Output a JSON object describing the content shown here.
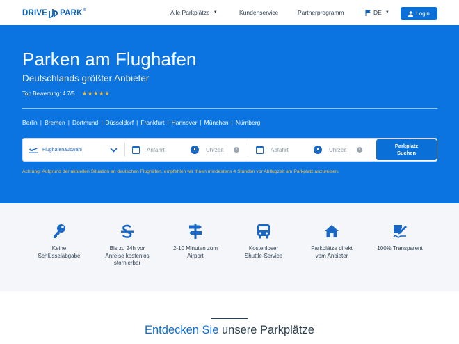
{
  "header": {
    "logo_left": "DRIVE",
    "logo_right": "PARK",
    "logo_reg": "®",
    "nav": {
      "parking": "Alle Parkplätze",
      "service": "Kundenservice",
      "partner": "Partnerprogramm",
      "language": "DE"
    },
    "login_label": "Login"
  },
  "hero": {
    "title": "Parken am Flughafen",
    "subtitle": "Deutschlands größter Anbieter",
    "rating_label": "Top Bewertung: 4.7/5",
    "stars": "★★★★★",
    "cities": [
      "Berlin",
      "Bremen",
      "Dortmund",
      "Düsseldorf",
      "Frankfurt",
      "Hannover",
      "München",
      "Nürnberg"
    ]
  },
  "search": {
    "airport_placeholder": "Flughafenauswahl",
    "arrival_placeholder": "Anfahrt",
    "arrival_time_placeholder": "Uhrzeit",
    "departure_placeholder": "Abfahrt",
    "departure_time_placeholder": "Uhrzeit",
    "button_line1": "Parkplatz",
    "button_line2": "Suchen"
  },
  "warning": "Achtung: Aufgrund der aktuellen Situation an deutschen Flughäfen, empfehlen wir Ihnen mindestens 4 Stunden vor Abflugzeit am Parkplatz anzureisen.",
  "features": [
    {
      "icon": "key-icon",
      "text_line1": "Keine",
      "text_line2": "Schlüsselabgabe",
      "text_line3": ""
    },
    {
      "icon": "strikethrough-s-icon",
      "text_line1": "Bis zu 24h vor",
      "text_line2": "Anreise kostenlos",
      "text_line3": "stornierbar"
    },
    {
      "icon": "signpost-icon",
      "text_line1": "2-10 Minuten zum",
      "text_line2": "Airport",
      "text_line3": ""
    },
    {
      "icon": "bus-icon",
      "text_line1": "Kostenloser",
      "text_line2": "Shuttle-Service",
      "text_line3": ""
    },
    {
      "icon": "home-icon",
      "text_line1": "Parkplätze direkt",
      "text_line2": "vom Anbieter",
      "text_line3": ""
    },
    {
      "icon": "signature-icon",
      "text_line1": "100% Transparent",
      "text_line2": "",
      "text_line3": ""
    }
  ],
  "discover": {
    "accent": "Entdecken Sie",
    "rest": " unsere Parkplätze"
  },
  "colors": {
    "brand_blue": "#0b74e0",
    "button_blue": "#0b6fd8",
    "star_gold": "#f5b93e",
    "warning_yellow": "#f7c14a"
  }
}
